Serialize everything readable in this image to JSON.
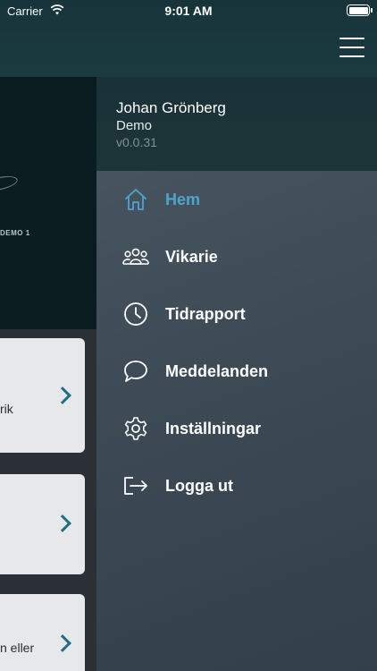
{
  "status_bar": {
    "carrier": "Carrier",
    "time": "9:01 AM"
  },
  "hero": {
    "label": "DEMO 1"
  },
  "cards": [
    {
      "text": "rik"
    },
    {
      "text": ""
    },
    {
      "text": "n eller"
    }
  ],
  "drawer": {
    "user_name": "Johan Grönberg",
    "organization": "Demo",
    "version": "v0.0.31",
    "items": [
      {
        "label": "Hem",
        "icon": "home-icon",
        "active": true
      },
      {
        "label": "Vikarie",
        "icon": "people-icon"
      },
      {
        "label": "Tidrapport",
        "icon": "clock-icon"
      },
      {
        "label": "Meddelanden",
        "icon": "chat-bubble-icon"
      },
      {
        "label": "Inställningar",
        "icon": "gear-icon"
      },
      {
        "label": "Logga ut",
        "icon": "logout-icon"
      }
    ]
  },
  "colors": {
    "accent": "#4fa3d1",
    "header": "#1b3b40",
    "drawer": "#3d4a55",
    "chevron": "#1f6e86"
  }
}
